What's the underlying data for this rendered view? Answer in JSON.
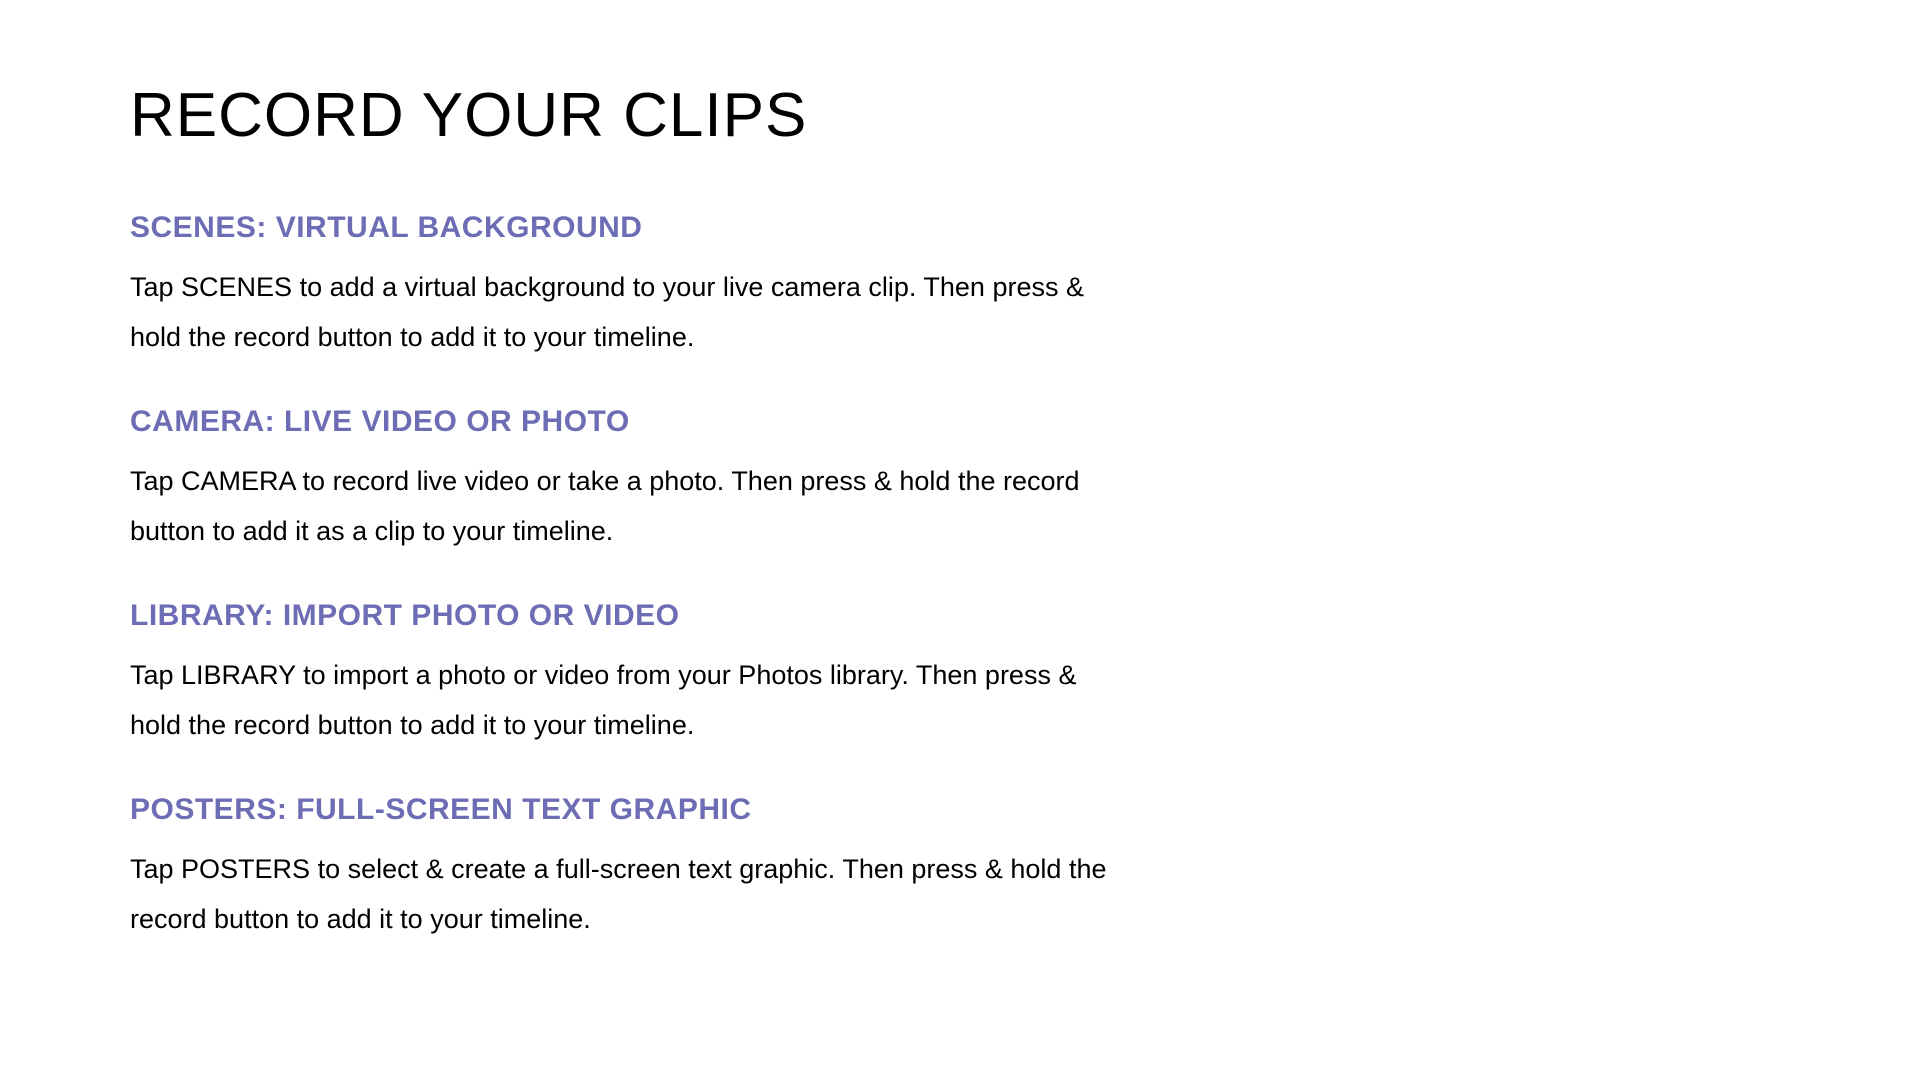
{
  "title": "RECORD YOUR CLIPS",
  "sections": [
    {
      "heading": "SCENES: VIRTUAL BACKGROUND",
      "body": "Tap SCENES to add a virtual background to your live camera clip. Then press & hold the record button to add it to your timeline."
    },
    {
      "heading": "CAMERA: LIVE VIDEO OR PHOTO",
      "body": "Tap CAMERA to record live video or take a photo. Then press & hold the record button to add it as a clip to your timeline."
    },
    {
      "heading": "LIBRARY: IMPORT PHOTO OR VIDEO",
      "body": "Tap LIBRARY to import a photo or video from your Photos library. Then press & hold the record button to add it to your timeline."
    },
    {
      "heading": "POSTERS: FULL-SCREEN TEXT GRAPHIC",
      "body": "Tap POSTERS to select & create a full-screen text graphic. Then press & hold the record button to add it to your timeline."
    }
  ]
}
